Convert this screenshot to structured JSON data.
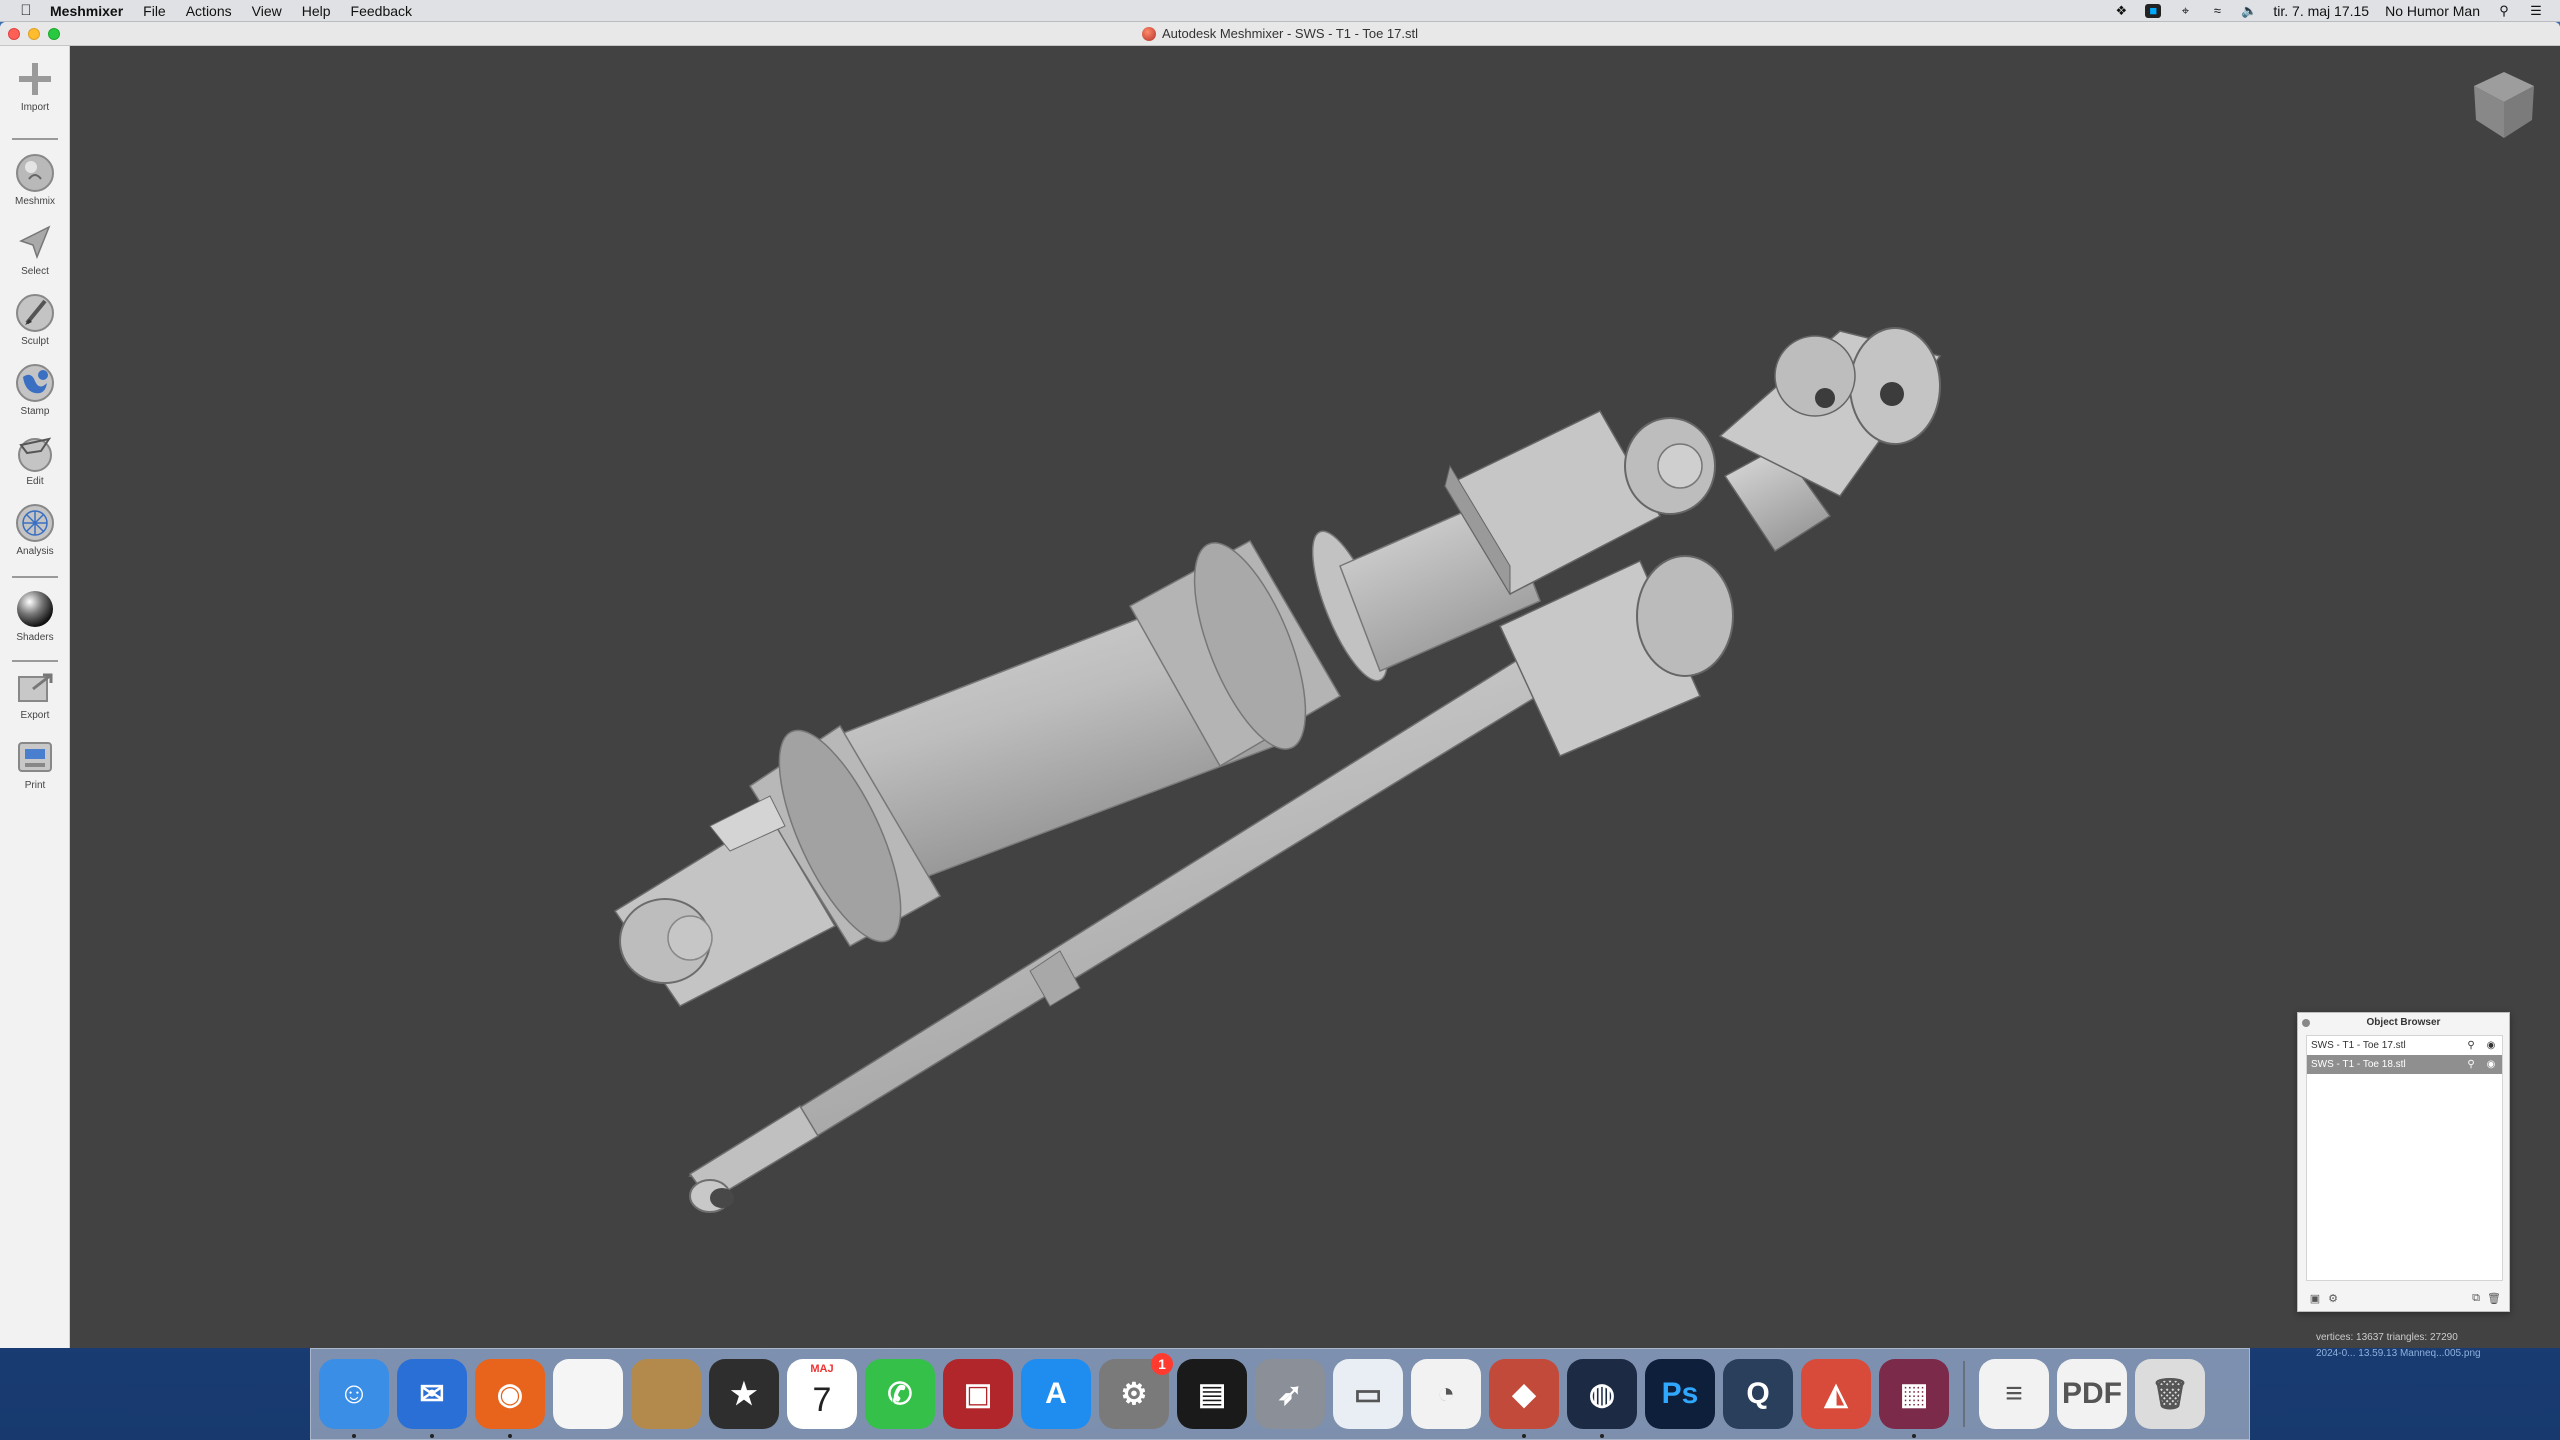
{
  "menubar": {
    "app_name": "Meshmixer",
    "menus": [
      "File",
      "Actions",
      "View",
      "Help",
      "Feedback"
    ],
    "clock": "tir. 7. maj  17.15",
    "user": "No Humor Man"
  },
  "window": {
    "title": "Autodesk Meshmixer - SWS - T1 - Toe 17.stl"
  },
  "toolbar": {
    "tools": [
      {
        "label": "Import",
        "icon": "plus-icon"
      },
      {
        "label": "Meshmix",
        "icon": "meshmix-icon"
      },
      {
        "label": "Select",
        "icon": "select-arrow-icon"
      },
      {
        "label": "Sculpt",
        "icon": "sculpt-brush-icon"
      },
      {
        "label": "Stamp",
        "icon": "stamp-icon"
      },
      {
        "label": "Edit",
        "icon": "edit-icon"
      },
      {
        "label": "Analysis",
        "icon": "analysis-icon"
      },
      {
        "label": "Shaders",
        "icon": "shaders-icon"
      },
      {
        "label": "Export",
        "icon": "export-icon"
      },
      {
        "label": "Print",
        "icon": "print-icon"
      }
    ]
  },
  "object_browser": {
    "title": "Object Browser",
    "items": [
      {
        "name": "SWS - T1 - Toe 17.stl",
        "selected": false
      },
      {
        "name": "SWS - T1 - Toe 18.stl",
        "selected": true
      }
    ]
  },
  "status": {
    "mesh_info": "vertices: 13637 triangles: 27290",
    "file_info": "2024-0... 13.59.13   Manneq...005.png"
  },
  "dock": {
    "apps": [
      {
        "name": "Finder",
        "color": "#3a8ee6",
        "glyph": "☺",
        "running": true
      },
      {
        "name": "Thunderbird",
        "color": "#2a6fd6",
        "glyph": "✉",
        "running": true
      },
      {
        "name": "Firefox",
        "color": "#e8631c",
        "glyph": "◉",
        "running": true
      },
      {
        "name": "TextEdit",
        "color": "#f5f5f5",
        "glyph": "",
        "running": false
      },
      {
        "name": "Notebook",
        "color": "#b48a4c",
        "glyph": "",
        "running": false
      },
      {
        "name": "iMovie",
        "color": "#2e2e2e",
        "glyph": "★",
        "running": false
      },
      {
        "name": "Calendar",
        "color": "#ffffff",
        "glyph": "7",
        "running": false
      },
      {
        "name": "FaceTime",
        "color": "#35c04a",
        "glyph": "✆",
        "running": false
      },
      {
        "name": "Photo Booth",
        "color": "#b0262a",
        "glyph": "▣",
        "running": false
      },
      {
        "name": "App Store",
        "color": "#1f8cf0",
        "glyph": "A",
        "running": false
      },
      {
        "name": "System Preferences",
        "color": "#7a7a7a",
        "glyph": "⚙",
        "running": false,
        "badge": "1"
      },
      {
        "name": "Activity Monitor",
        "color": "#1a1a1a",
        "glyph": "▤",
        "running": false
      },
      {
        "name": "Launchpad",
        "color": "#8a8f98",
        "glyph": "➶",
        "running": false
      },
      {
        "name": "Rulers",
        "color": "#e9eef4",
        "glyph": "▭",
        "running": false
      },
      {
        "name": "Blender",
        "color": "#f2f2f2",
        "glyph": "◔",
        "running": false
      },
      {
        "name": "Meshmixer",
        "color": "#c24a3a",
        "glyph": "◆",
        "running": true
      },
      {
        "name": "Cinema 4D",
        "color": "#1c2a44",
        "glyph": "◍",
        "running": true
      },
      {
        "name": "Photoshop",
        "color": "#0d1f3a",
        "glyph": "Ps",
        "running": false
      },
      {
        "name": "QuickTime",
        "color": "#2a3f5c",
        "glyph": "Q",
        "running": false
      },
      {
        "name": "Affinity",
        "color": "#d84b3a",
        "glyph": "◭",
        "running": false
      },
      {
        "name": "Mosaic",
        "color": "#7b2a4a",
        "glyph": "▦",
        "running": true
      }
    ],
    "docs": [
      {
        "name": "Document",
        "color": "#f2f2f2",
        "glyph": "≡"
      },
      {
        "name": "PDF",
        "color": "#f2f2f2",
        "glyph": "PDF"
      },
      {
        "name": "Trash",
        "color": "#dcdcdc",
        "glyph": "🗑"
      }
    ],
    "calendar_month": "MAJ"
  },
  "colors": {
    "viewport_bg": "#424242",
    "model_fill": "#b8b8b8",
    "selection_bg": "#8f8f8f"
  }
}
